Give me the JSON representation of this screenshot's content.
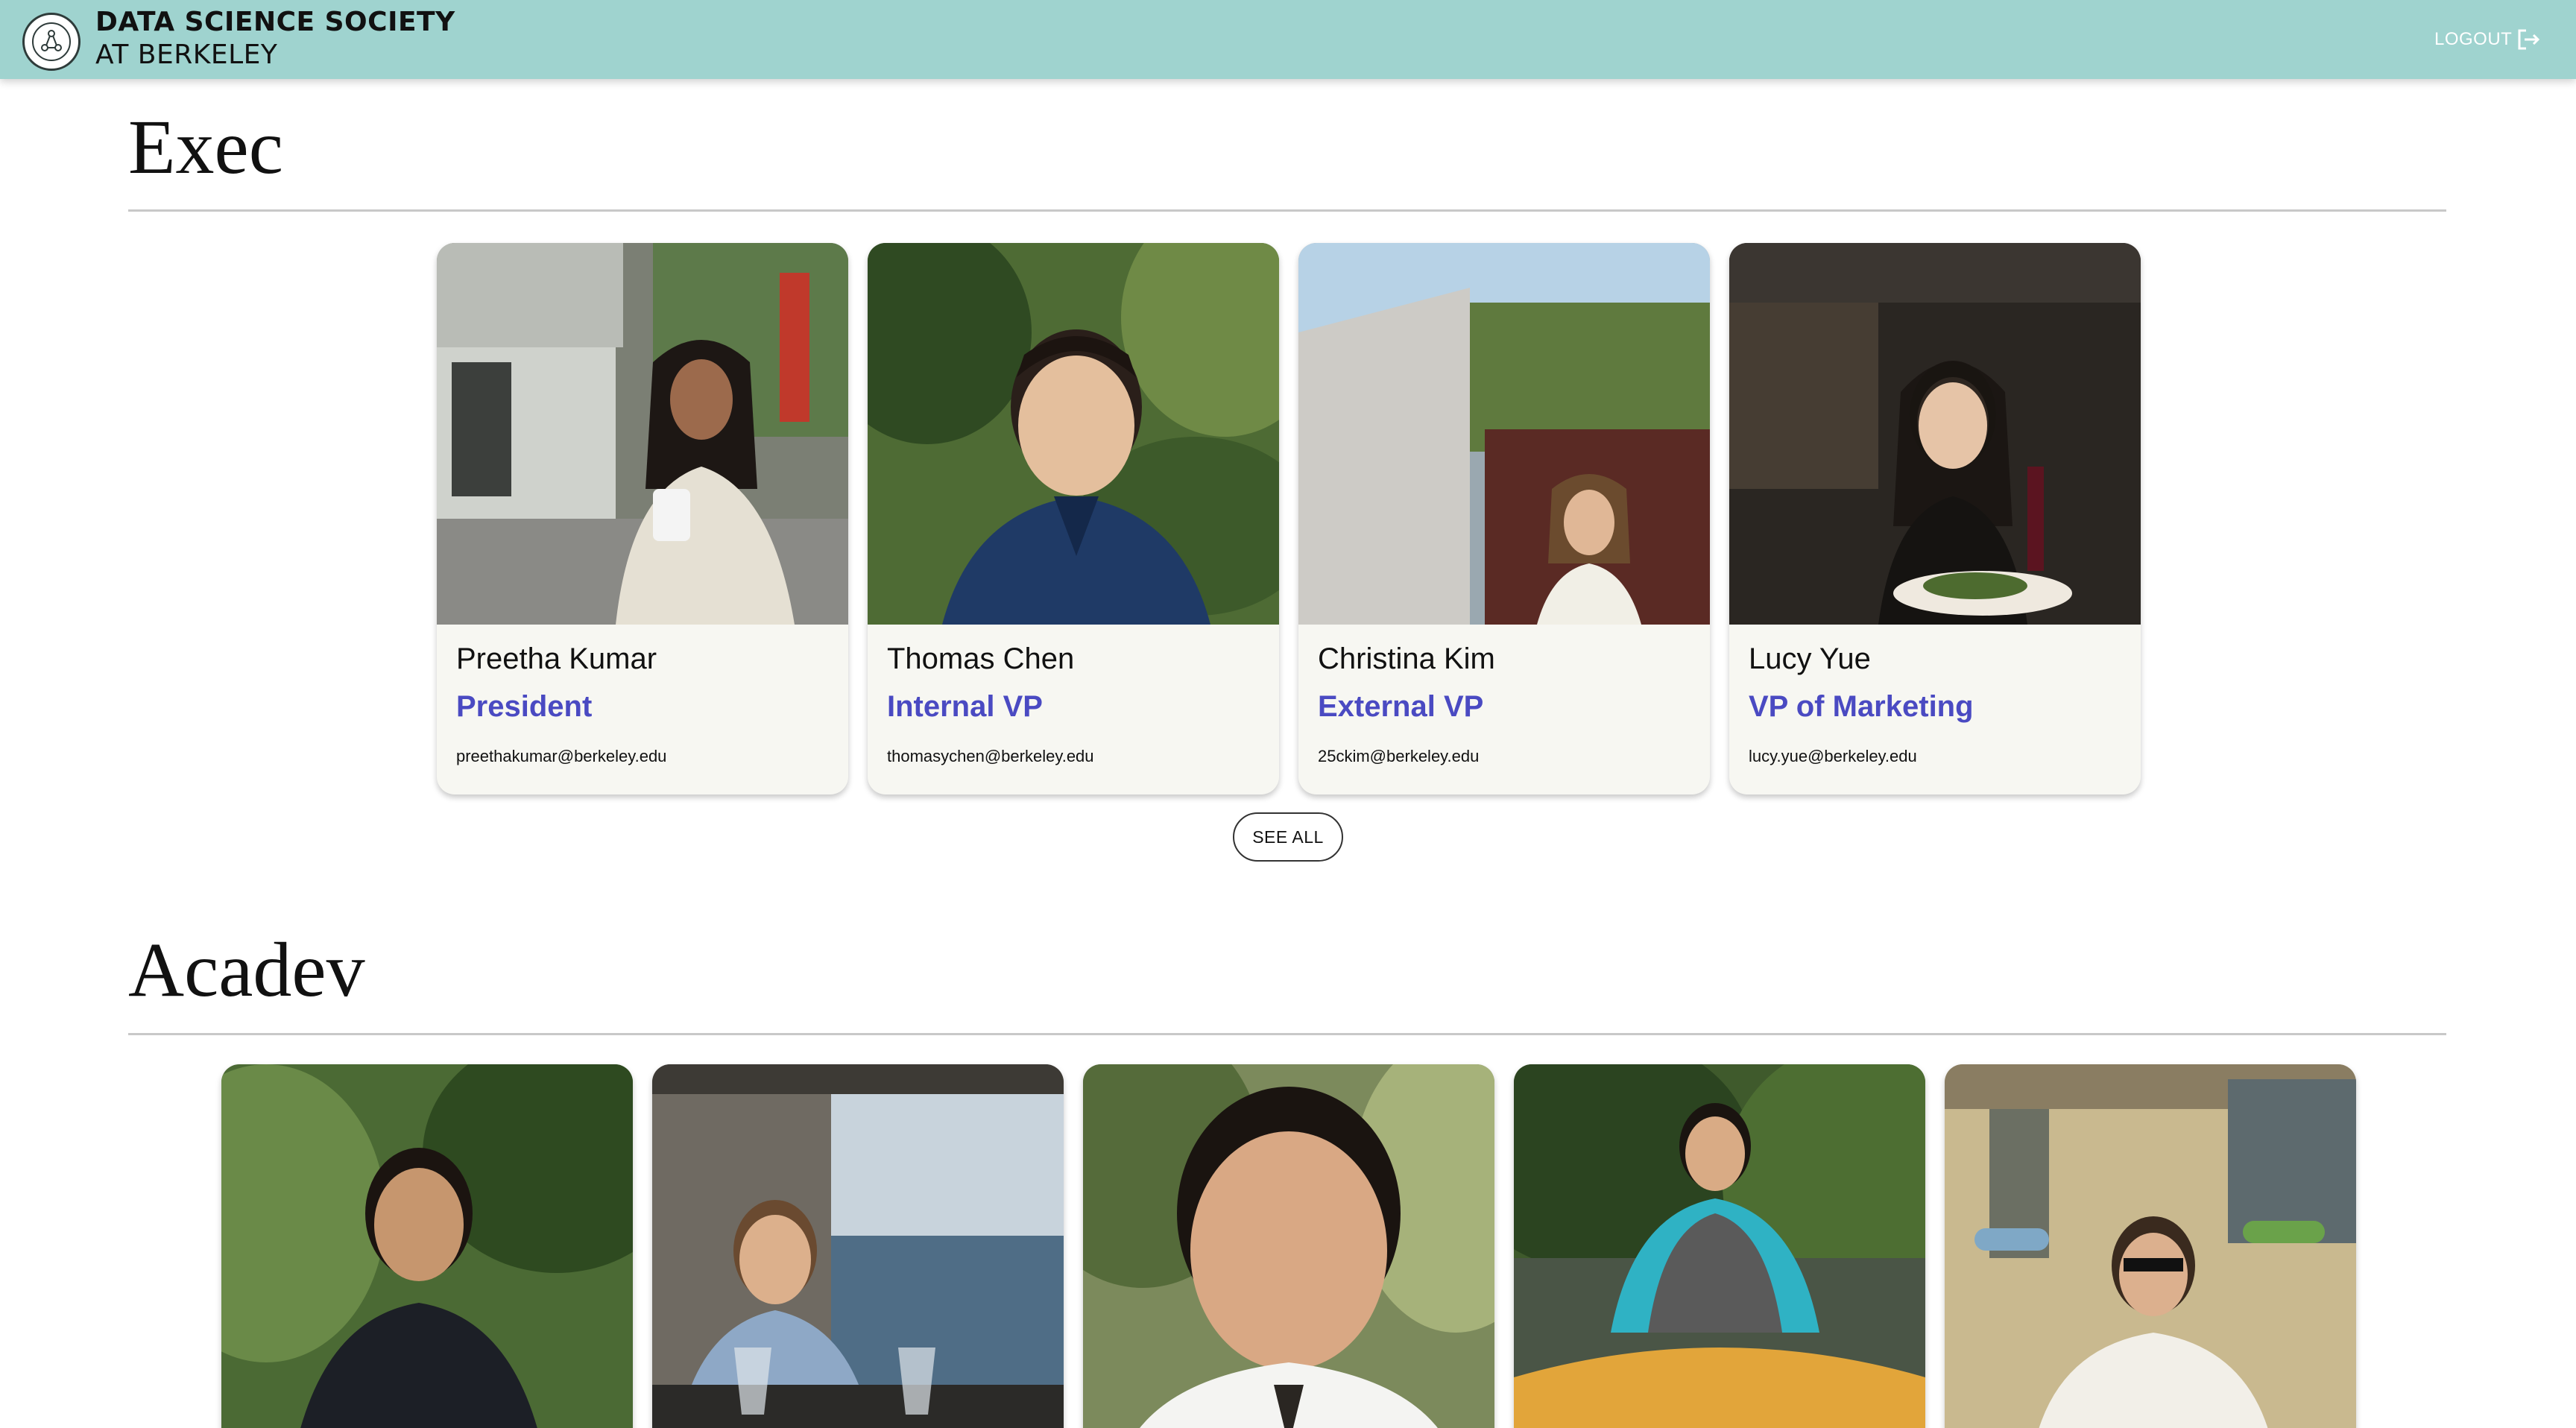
{
  "header": {
    "brand_line1": "DATA SCIENCE SOCIETY",
    "brand_line2": "AT BERKELEY",
    "logout_label": "LOGOUT",
    "bg_color": "#9fd3cf"
  },
  "sections": [
    {
      "title": "Exec",
      "members": [
        {
          "name": "Preetha Kumar",
          "role": "President",
          "email": "preethakumar@berkeley.edu"
        },
        {
          "name": "Thomas Chen",
          "role": "Internal VP",
          "email": "thomasychen@berkeley.edu"
        },
        {
          "name": "Christina Kim",
          "role": "External VP",
          "email": "25ckim@berkeley.edu"
        },
        {
          "name": "Lucy Yue",
          "role": "VP of Marketing",
          "email": "lucy.yue@berkeley.edu"
        }
      ],
      "see_all_label": "SEE ALL"
    },
    {
      "title": "Acadev",
      "members": [
        {},
        {},
        {},
        {},
        {}
      ]
    }
  ],
  "colors": {
    "role_text": "#4a4ac2",
    "card_bg": "#f7f7f2"
  }
}
